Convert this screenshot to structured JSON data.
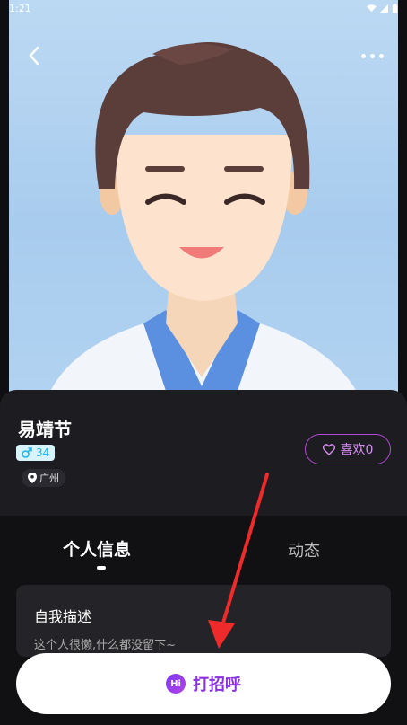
{
  "status_bar": {
    "time": "1:21",
    "icons": [
      "wifi-icon",
      "signal-icon",
      "battery-icon"
    ]
  },
  "header": {
    "back_icon": "chevron-left-icon",
    "more_icon": "more-dots-icon"
  },
  "profile": {
    "name": "易靖节",
    "gender_icon": "male-icon",
    "age": "34",
    "location_icon": "location-pin-icon",
    "location": "广州",
    "like_icon": "heart-icon",
    "like_label": "喜欢0"
  },
  "tabs": [
    {
      "label": "个人信息",
      "active": true
    },
    {
      "label": "动态",
      "active": false
    }
  ],
  "self_description": {
    "title": "自我描述",
    "text": "这个人很懒,什么都没留下~"
  },
  "greet_button": {
    "icon_text": "Hi",
    "label": "打招呼"
  },
  "colors": {
    "accent_purple": "#8a32e0",
    "like_border": "#b44bd6",
    "gender_badge": "#1fb5e6",
    "annotation_arrow": "#ee2a2a"
  }
}
